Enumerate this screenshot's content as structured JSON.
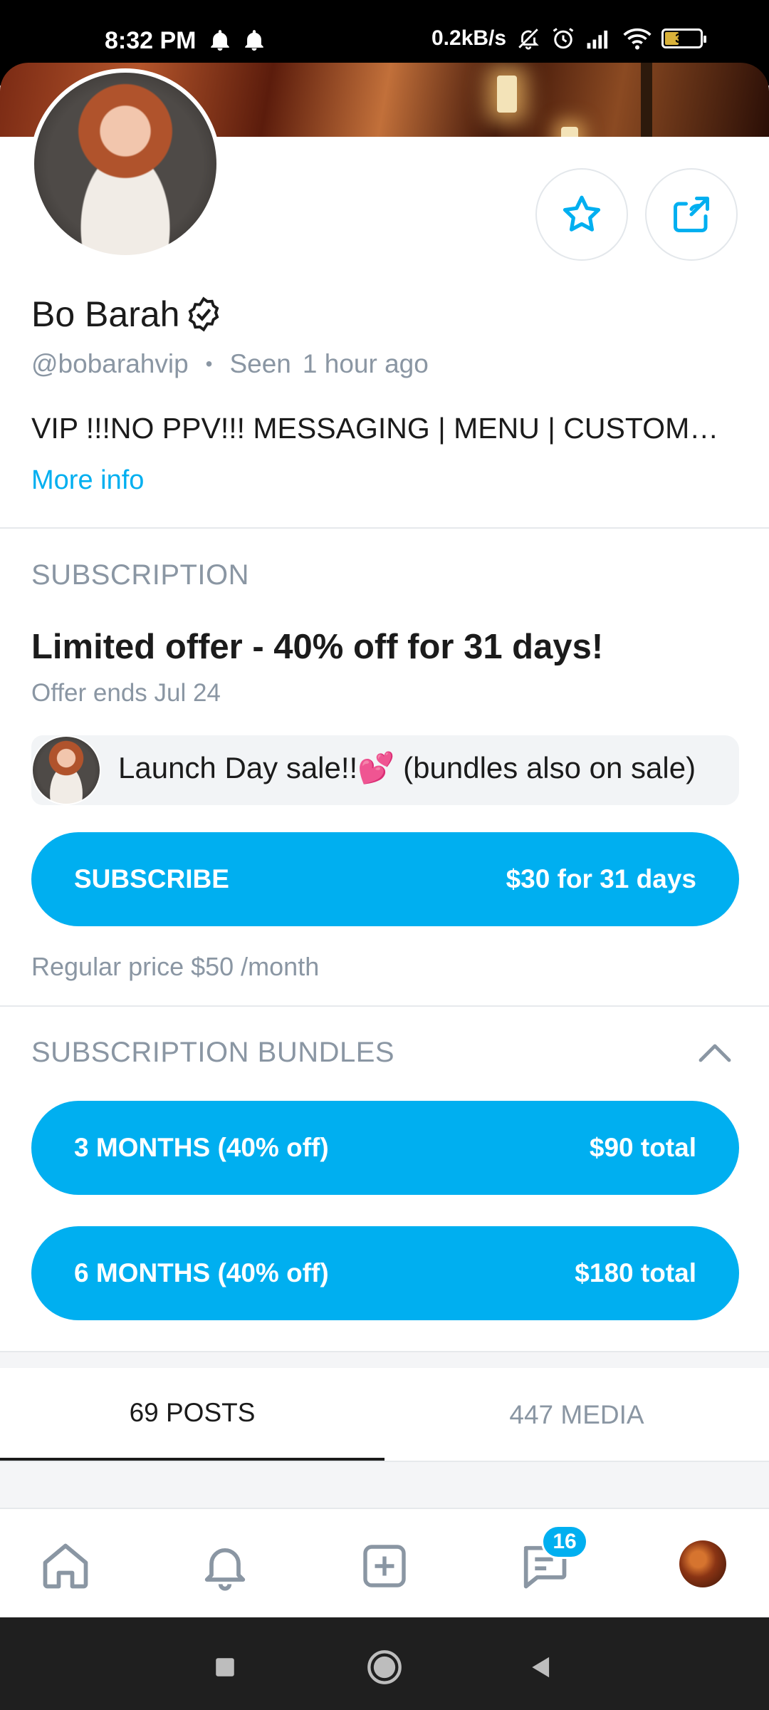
{
  "status_bar": {
    "time": "8:32 PM",
    "network_speed": "0.2kB/s",
    "battery_level": "36",
    "icons": [
      "bell-icon",
      "bell-icon",
      "mute-icon",
      "alarm-icon",
      "signal-icon",
      "wifi-icon",
      "battery-icon"
    ]
  },
  "profile": {
    "name": "Bo Barah",
    "handle": "@bobarahvip",
    "seen_label": "Seen",
    "seen_time": "1 hour ago",
    "bio": "VIP !!!NO PPV!!! MESSAGING | MENU | CUSTOMS…",
    "more_info": "More info"
  },
  "subscription": {
    "section_title": "SUBSCRIPTION",
    "offer_title": "Limited offer - 40% off for 31 days!",
    "offer_ends": "Offer ends Jul 24",
    "promo_message": "Launch Day sale!!💕 (bundles also on sale)",
    "subscribe_label": "SUBSCRIBE",
    "subscribe_price": "$30 for 31 days",
    "regular_price": "Regular price $50 /month"
  },
  "bundles": {
    "section_title": "SUBSCRIPTION BUNDLES",
    "items": [
      {
        "label": "3 MONTHS (40% off)",
        "price": "$90 total"
      },
      {
        "label": "6 MONTHS (40% off)",
        "price": "$180 total"
      }
    ]
  },
  "tabs": [
    {
      "label": "69 POSTS",
      "active": true
    },
    {
      "label": "447 MEDIA",
      "active": false
    }
  ],
  "bottom_nav": {
    "messages_badge": "16",
    "items": [
      "home-icon",
      "notifications-icon",
      "add-post-icon",
      "messages-icon",
      "profile-avatar"
    ]
  },
  "colors": {
    "accent": "#00aff0",
    "muted_text": "#8a96a3",
    "text": "#1b1b1b"
  }
}
